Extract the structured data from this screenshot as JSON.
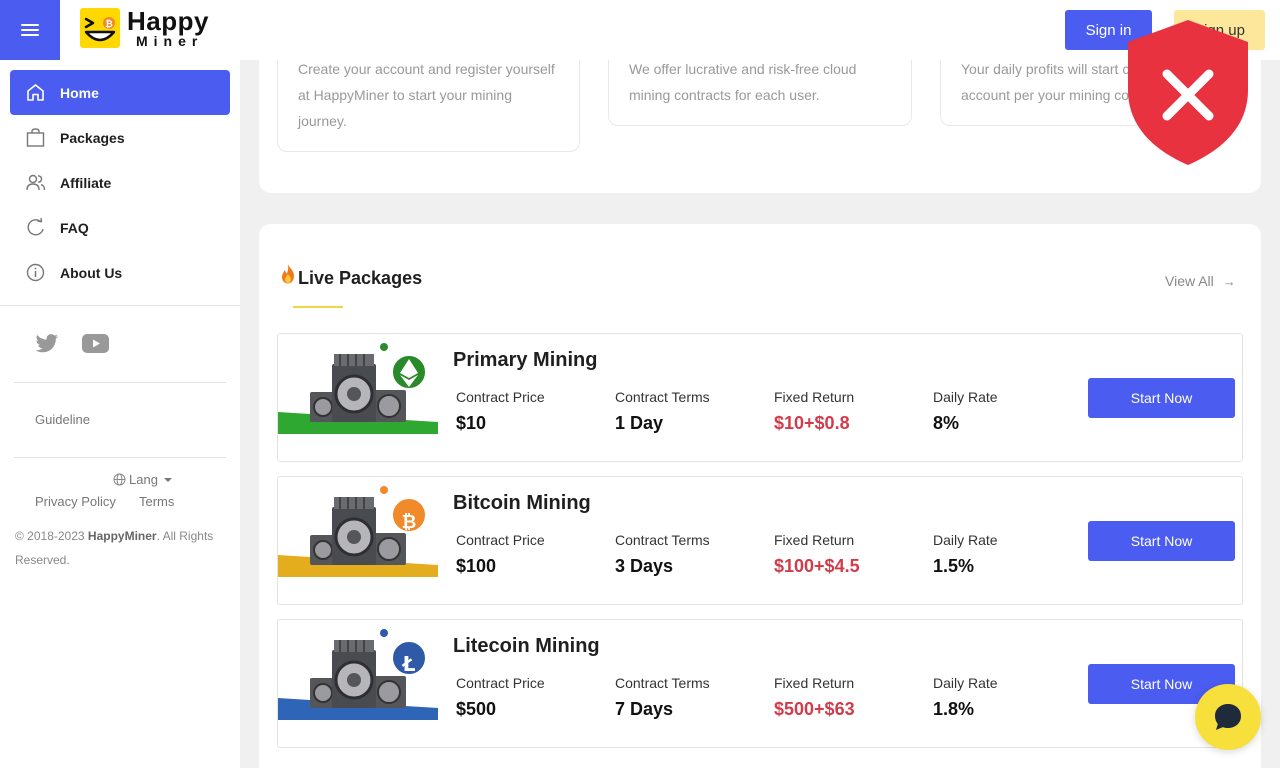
{
  "header": {
    "logo_line1": "Happy",
    "logo_line2": "Miner",
    "signin_label": "Sign in",
    "signup_label": "Sign up"
  },
  "sidebar": {
    "items": [
      {
        "label": "Home",
        "icon": "home-icon",
        "active": true
      },
      {
        "label": "Packages",
        "icon": "bag-icon",
        "active": false
      },
      {
        "label": "Affiliate",
        "icon": "users-icon",
        "active": false
      },
      {
        "label": "FAQ",
        "icon": "refresh-icon",
        "active": false
      },
      {
        "label": "About Us",
        "icon": "info-icon",
        "active": false
      }
    ],
    "guideline": "Guideline",
    "lang": "Lang",
    "privacy": "Privacy Policy",
    "terms": "Terms",
    "copyright_prefix": "© 2018-2023 ",
    "copyright_brand": "HappyMiner",
    "copyright_suffix": ". All Rights Reserved."
  },
  "steps": [
    {
      "text": "Create your account and register yourself at HappyMiner to start your mining journey."
    },
    {
      "text": "We offer lucrative and risk-free cloud mining contracts for each user."
    },
    {
      "text": "Your daily profits will start crediting to your account per your mining contract."
    }
  ],
  "live": {
    "title": "Live Packages",
    "view_all": "View All",
    "field_labels": {
      "price": "Contract Price",
      "terms": "Contract Terms",
      "return": "Fixed Return",
      "rate": "Daily Rate"
    },
    "start_label": "Start Now",
    "packages": [
      {
        "name": "Primary Mining",
        "price": "$10",
        "terms": "1 Day",
        "return": "$10+$0.8",
        "rate": "8%",
        "coin": "ethereum",
        "color": "#2ea830",
        "dot": "#2e8b2e"
      },
      {
        "name": "Bitcoin Mining",
        "price": "$100",
        "terms": "3 Days",
        "return": "$100+$4.5",
        "rate": "1.5%",
        "coin": "bitcoin",
        "color": "#e3ad1d",
        "dot": "#f08a2a"
      },
      {
        "name": "Litecoin Mining",
        "price": "$500",
        "terms": "7 Days",
        "return": "$500+$63",
        "rate": "1.8%",
        "coin": "litecoin",
        "color": "#2f65b6",
        "dot": "#2f5aa8"
      }
    ]
  },
  "colors": {
    "primary": "#4b5cf0",
    "accent_yellow": "#ffd800",
    "return_red": "#d43b4a",
    "alert_red": "#e8323f"
  }
}
